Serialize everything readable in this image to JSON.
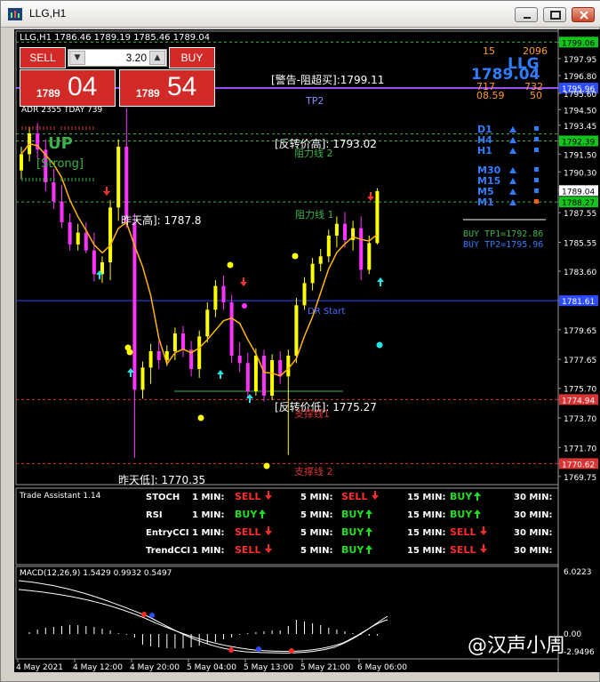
{
  "window": {
    "title": "LLG,H1"
  },
  "trade_panel": {
    "sell_label": "SELL",
    "buy_label": "BUY",
    "lot": "3.20",
    "sell_small": "1789",
    "sell_big": "04",
    "buy_small": "1789",
    "buy_big": "54"
  },
  "chart": {
    "header": "LLG,H1  1786.46 1789.19 1785.46 1789.04",
    "indicator_label": "ADR 2355  TDAY 739",
    "symbol": "LLG",
    "price_large": "1789.04",
    "stats": [
      "15",
      "2096",
      "717",
      "732",
      "08.59",
      "50"
    ],
    "current_price_tag": "1789.04",
    "y_axis_labels": [
      {
        "value": 1799.06,
        "text": "1799.06",
        "tag": "green"
      },
      {
        "value": 1797.95,
        "text": "1797.95"
      },
      {
        "value": 1796.8,
        "text": "1796.80"
      },
      {
        "value": 1795.96,
        "text": "1795.96",
        "tag": "blue"
      },
      {
        "value": 1795.6,
        "text": "1795.60"
      },
      {
        "value": 1794.5,
        "text": "1794.50"
      },
      {
        "value": 1793.45,
        "text": "1793.45"
      },
      {
        "value": 1792.39,
        "text": "1792.39",
        "tag": "green"
      },
      {
        "value": 1791.5,
        "text": "1791.50"
      },
      {
        "value": 1790.3,
        "text": "1790.30"
      },
      {
        "value": 1789.04,
        "text": "1789.04",
        "tag": "white"
      },
      {
        "value": 1788.27,
        "text": "1788.27",
        "tag": "green"
      },
      {
        "value": 1787.55,
        "text": "1787.55"
      },
      {
        "value": 1785.55,
        "text": "1785.55"
      },
      {
        "value": 1783.6,
        "text": "1783.60"
      },
      {
        "value": 1781.61,
        "text": "1781.61",
        "tag": "blue"
      },
      {
        "value": 1779.65,
        "text": "1779.65"
      },
      {
        "value": 1777.65,
        "text": "1777.65"
      },
      {
        "value": 1775.7,
        "text": "1775.70"
      },
      {
        "value": 1774.94,
        "text": "1774.94",
        "tag": "red"
      },
      {
        "value": 1773.7,
        "text": "1773.70"
      },
      {
        "value": 1771.7,
        "text": "1771.70"
      },
      {
        "value": 1770.62,
        "text": "1770.62",
        "tag": "red"
      },
      {
        "value": 1769.75,
        "text": "1769.75"
      }
    ],
    "annotations": {
      "warn_top": "[警告-阻超买]:1799.11",
      "tp2": "TP2",
      "reversal_high": "[反转价高]: 1793.02",
      "resistance2": "阻力线 2",
      "prev_high": "昨天高]: 1787.8",
      "resistance1": "阻力线 1",
      "dr_start": "DR Start",
      "reversal_low": "[反转价低]: 1775.27",
      "support1": "支撑线1",
      "prev_low": "昨天低]: 1770.35",
      "support2": "支撑线 2",
      "up": "UP",
      "strong": "[Strong]"
    },
    "timeframes": [
      "D1",
      "H4",
      "H1",
      "M30",
      "M15",
      "M5",
      "M1"
    ],
    "buy_tp1": "BUY TP1=1792.86",
    "buy_tp2": "BUY TP2=1795.96"
  },
  "trade_assistant": {
    "title": "Trade Assistant 1.14",
    "rows": [
      {
        "name": "STOCH",
        "cells": [
          [
            "1 MIN:",
            "SELL",
            "down"
          ],
          [
            "5 MIN:",
            "SELL",
            "down"
          ],
          [
            "15 MIN:",
            "BUY",
            "up"
          ],
          [
            "30 MIN:",
            "",
            ""
          ]
        ]
      },
      {
        "name": "RSI",
        "cells": [
          [
            "1 MIN:",
            "BUY",
            "up"
          ],
          [
            "5 MIN:",
            "BUY",
            "up"
          ],
          [
            "15 MIN:",
            "BUY",
            "up"
          ],
          [
            "30 MIN:",
            "",
            ""
          ]
        ]
      },
      {
        "name": "EntryCCI",
        "cells": [
          [
            "1 MIN:",
            "SELL",
            "down"
          ],
          [
            "5 MIN:",
            "BUY",
            "up"
          ],
          [
            "15 MIN:",
            "SELL",
            "down"
          ],
          [
            "30 MIN:",
            "",
            ""
          ]
        ]
      },
      {
        "name": "TrendCCI",
        "cells": [
          [
            "1 MIN:",
            "SELL",
            "down"
          ],
          [
            "5 MIN:",
            "BUY",
            "up"
          ],
          [
            "15 MIN:",
            "SELL",
            "down"
          ],
          [
            "30 MIN:",
            "",
            ""
          ]
        ]
      }
    ]
  },
  "macd": {
    "label": "MACD(12,26,9) 1.5429 0.9932 0.5497",
    "scale_top": "6.0223",
    "scale_zero": "0.00",
    "scale_bottom": "-2.9496"
  },
  "time_axis": [
    "4 May 2021",
    "4 May 12:00",
    "4 May 20:00",
    "5 May 04:00",
    "5 May 13:00",
    "5 May 21:00",
    "6 May 06:00"
  ],
  "watermark": "@汉声小周",
  "candles": [
    [
      1790.4,
      1792.0,
      1789.8,
      1791.5
    ],
    [
      1791.5,
      1793.3,
      1791.0,
      1792.9
    ],
    [
      1792.9,
      1793.6,
      1791.2,
      1791.8
    ],
    [
      1791.8,
      1792.5,
      1789.0,
      1789.6
    ],
    [
      1789.6,
      1790.5,
      1787.8,
      1788.3
    ],
    [
      1788.3,
      1789.4,
      1786.5,
      1786.9
    ],
    [
      1786.9,
      1787.5,
      1785.0,
      1785.4
    ],
    [
      1785.4,
      1786.8,
      1785.0,
      1786.2
    ],
    [
      1786.2,
      1786.9,
      1784.8,
      1785.0
    ],
    [
      1785.0,
      1786.2,
      1782.9,
      1783.4
    ],
    [
      1783.4,
      1784.6,
      1782.8,
      1784.2
    ],
    [
      1784.2,
      1788.4,
      1783.0,
      1787.9
    ],
    [
      1787.9,
      1792.5,
      1787.0,
      1792.0
    ],
    [
      1792.0,
      1794.6,
      1786.5,
      1786.9
    ],
    [
      1786.9,
      1787.5,
      1771.0,
      1775.6
    ],
    [
      1775.6,
      1777.5,
      1775.0,
      1777.1
    ],
    [
      1777.1,
      1778.7,
      1776.0,
      1778.2
    ],
    [
      1778.2,
      1778.9,
      1777.0,
      1777.6
    ],
    [
      1777.6,
      1778.6,
      1777.2,
      1778.2
    ],
    [
      1778.2,
      1779.8,
      1777.6,
      1779.4
    ],
    [
      1779.4,
      1779.9,
      1777.8,
      1778.3
    ],
    [
      1778.3,
      1778.9,
      1776.5,
      1777.0
    ],
    [
      1777.0,
      1779.6,
      1776.4,
      1779.2
    ],
    [
      1779.2,
      1781.5,
      1778.8,
      1781.0
    ],
    [
      1781.0,
      1783.0,
      1780.5,
      1782.6
    ],
    [
      1782.6,
      1783.3,
      1781.0,
      1781.5
    ],
    [
      1781.5,
      1782.0,
      1777.4,
      1777.9
    ],
    [
      1777.9,
      1778.8,
      1776.8,
      1777.4
    ],
    [
      1777.4,
      1778.1,
      1775.0,
      1775.5
    ],
    [
      1775.5,
      1778.4,
      1775.2,
      1777.9
    ],
    [
      1777.9,
      1778.3,
      1774.8,
      1775.2
    ],
    [
      1775.2,
      1778.0,
      1774.9,
      1777.6
    ],
    [
      1777.6,
      1778.2,
      1776.0,
      1776.5
    ],
    [
      1776.5,
      1778.3,
      1771.2,
      1777.9
    ],
    [
      1777.9,
      1781.8,
      1777.4,
      1781.3
    ],
    [
      1781.3,
      1783.2,
      1781.0,
      1782.8
    ],
    [
      1782.8,
      1784.5,
      1782.3,
      1784.1
    ],
    [
      1784.1,
      1785.1,
      1783.6,
      1784.6
    ],
    [
      1784.6,
      1786.4,
      1784.2,
      1786.0
    ],
    [
      1786.0,
      1787.3,
      1785.2,
      1786.8
    ],
    [
      1786.8,
      1787.6,
      1785.2,
      1785.7
    ],
    [
      1785.7,
      1787.0,
      1785.0,
      1786.5
    ],
    [
      1786.5,
      1787.3,
      1783.0,
      1783.7
    ],
    [
      1783.7,
      1786.0,
      1783.4,
      1785.5
    ],
    [
      1785.5,
      1789.2,
      1785.4,
      1789.0
    ]
  ]
}
